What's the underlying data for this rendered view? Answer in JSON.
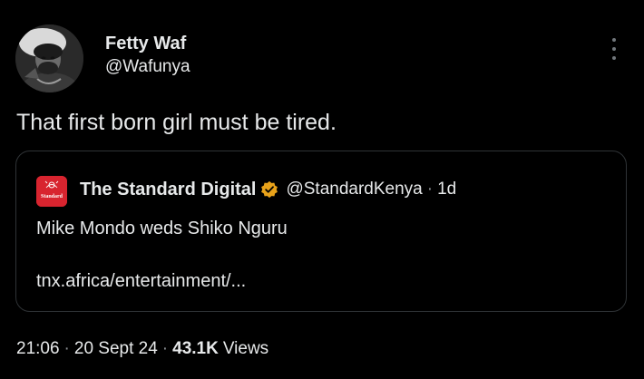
{
  "tweet": {
    "author": {
      "display_name": "Fetty Waf",
      "handle": "@Wafunya",
      "avatar_icon": "user-avatar-photo"
    },
    "text": "That first born girl must be tired.",
    "more_icon": "more-vertical-icon",
    "quote": {
      "avatar_icon": "standard-logo",
      "avatar_logo_text": "Standard",
      "avatar_color": "#d8242f",
      "name": "The Standard Digital",
      "verified_icon": "verified-gold-badge",
      "verified_color": "#e8a21a",
      "handle": "@StandardKenya",
      "separator": "·",
      "time": "1d",
      "text": "Mike Mondo weds Shiko Nguru",
      "link": "tnx.africa/entertainment/..."
    },
    "meta": {
      "time": "21:06",
      "separator": "·",
      "date": "20 Sept 24",
      "views_count": "43.1K",
      "views_label": "Views"
    }
  },
  "colors": {
    "background": "#000000",
    "text": "#e7e9ea",
    "secondary_text": "#71767b",
    "border": "#2f3336"
  }
}
